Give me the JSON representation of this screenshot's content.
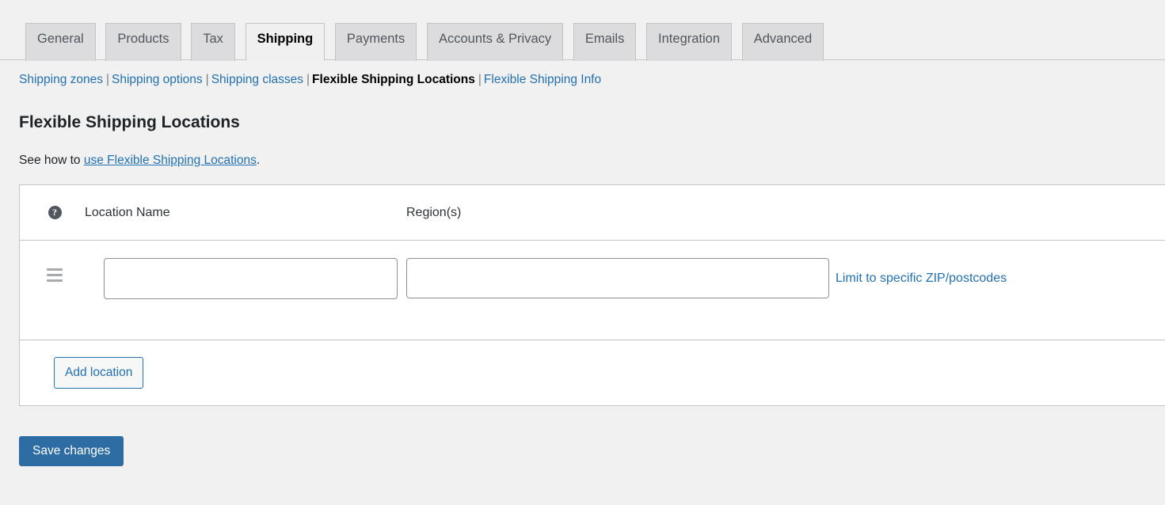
{
  "tabs": [
    {
      "label": "General",
      "active": false
    },
    {
      "label": "Products",
      "active": false
    },
    {
      "label": "Tax",
      "active": false
    },
    {
      "label": "Shipping",
      "active": true
    },
    {
      "label": "Payments",
      "active": false
    },
    {
      "label": "Accounts & Privacy",
      "active": false
    },
    {
      "label": "Emails",
      "active": false
    },
    {
      "label": "Integration",
      "active": false
    },
    {
      "label": "Advanced",
      "active": false
    }
  ],
  "subnav": {
    "separator": "|",
    "items": [
      {
        "label": "Shipping zones",
        "current": false
      },
      {
        "label": "Shipping options",
        "current": false
      },
      {
        "label": "Shipping classes",
        "current": false
      },
      {
        "label": "Flexible Shipping Locations",
        "current": true
      },
      {
        "label": "Flexible Shipping Info",
        "current": false
      }
    ]
  },
  "page": {
    "title": "Flexible Shipping Locations",
    "description_prefix": "See how to ",
    "description_link": "use Flexible Shipping Locations",
    "description_suffix": "."
  },
  "table": {
    "help_icon_glyph": "?",
    "help_icon_name": "question-mark-icon",
    "columns": {
      "location_name": "Location Name",
      "regions": "Region(s)"
    },
    "rows": [
      {
        "drag_handle_name": "drag-handle-icon",
        "location_name_value": "",
        "location_name_placeholder": "",
        "region_value": "",
        "region_placeholder": "",
        "zip_link_label": "Limit to specific ZIP/postcodes"
      }
    ],
    "add_location_label": "Add location"
  },
  "footer": {
    "save_label": "Save changes"
  },
  "colors": {
    "page_background": "#f1f1f1",
    "accent_link": "#2271b1",
    "primary_button": "#2e6da4",
    "tab_inactive": "#dcdcde",
    "tab_active": "#f0f0f1",
    "border": "#c3c4c7",
    "input_border": "#8c8f94",
    "help_icon": "#50575e",
    "drag_handle": "#a7aaad"
  }
}
